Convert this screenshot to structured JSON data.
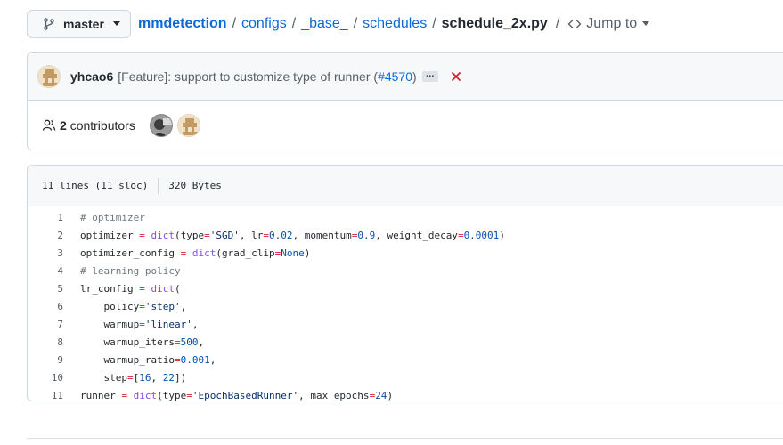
{
  "breadcrumb": {
    "branch": "master",
    "repo": "mmdetection",
    "path": [
      "configs",
      "_base_",
      "schedules"
    ],
    "file": "schedule_2x.py",
    "separator": "/",
    "jump_label": "Jump to",
    "icons": [
      "git-branch-icon",
      "chevron-down-icon",
      "code-icon"
    ]
  },
  "commit": {
    "author": "yhcao6",
    "message": "[Feature]: support to customize type of runner",
    "pr_open": " (",
    "pr": "#4570",
    "pr_close": ")",
    "ellipsis": "…",
    "status": "failed",
    "status_color": "#cf222e"
  },
  "contributors": {
    "count": "2",
    "label": "contributors"
  },
  "file": {
    "lines": "11 lines (11 sloc)",
    "size": "320 Bytes"
  },
  "code_lines": [
    "# optimizer",
    "optimizer = dict(type='SGD', lr=0.02, momentum=0.9, weight_decay=0.0001)",
    "optimizer_config = dict(grad_clip=None)",
    "# learning policy",
    "lr_config = dict(",
    "    policy='step',",
    "    warmup='linear',",
    "    warmup_iters=500,",
    "    warmup_ratio=0.001,",
    "    step=[16, 22])",
    "runner = dict(type='EpochBasedRunner', max_epochs=24)"
  ],
  "colors": {
    "link": "#0969da",
    "border": "#d0d7de",
    "header_bg": "#f6f8fa"
  }
}
